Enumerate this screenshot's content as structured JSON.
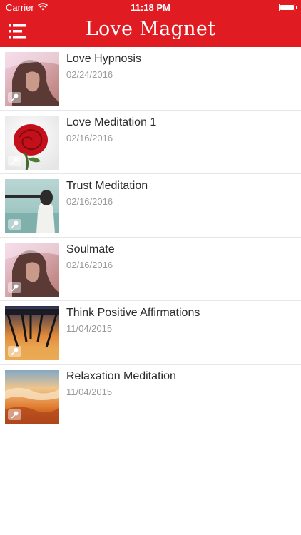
{
  "status_bar": {
    "carrier": "Carrier",
    "time": "11:18 PM"
  },
  "nav": {
    "title": "Love Magnet",
    "menu_icon": "menu-icon"
  },
  "colors": {
    "brand_red": "#e11b22",
    "title_text": "#2b2b2b",
    "date_text": "#9a9a9a",
    "divider": "#e7e7e7"
  },
  "items": [
    {
      "title": "Love Hypnosis",
      "date": "02/24/2016",
      "thumbnail": "woman-portrait-image",
      "badge_icon": "microphone-icon"
    },
    {
      "title": "Love Meditation 1",
      "date": "02/16/2016",
      "thumbnail": "red-rose-image",
      "badge_icon": "microphone-icon"
    },
    {
      "title": "Trust Meditation",
      "date": "02/16/2016",
      "thumbnail": "blindfolded-woman-image",
      "badge_icon": "microphone-icon"
    },
    {
      "title": "Soulmate",
      "date": "02/16/2016",
      "thumbnail": "woman-portrait-image",
      "badge_icon": "microphone-icon"
    },
    {
      "title": "Think Positive Affirmations",
      "date": "11/04/2015",
      "thumbnail": "pier-sunset-image",
      "badge_icon": "microphone-icon"
    },
    {
      "title": "Relaxation Meditation",
      "date": "11/04/2015",
      "thumbnail": "sunset-clouds-image",
      "badge_icon": "microphone-icon"
    }
  ]
}
